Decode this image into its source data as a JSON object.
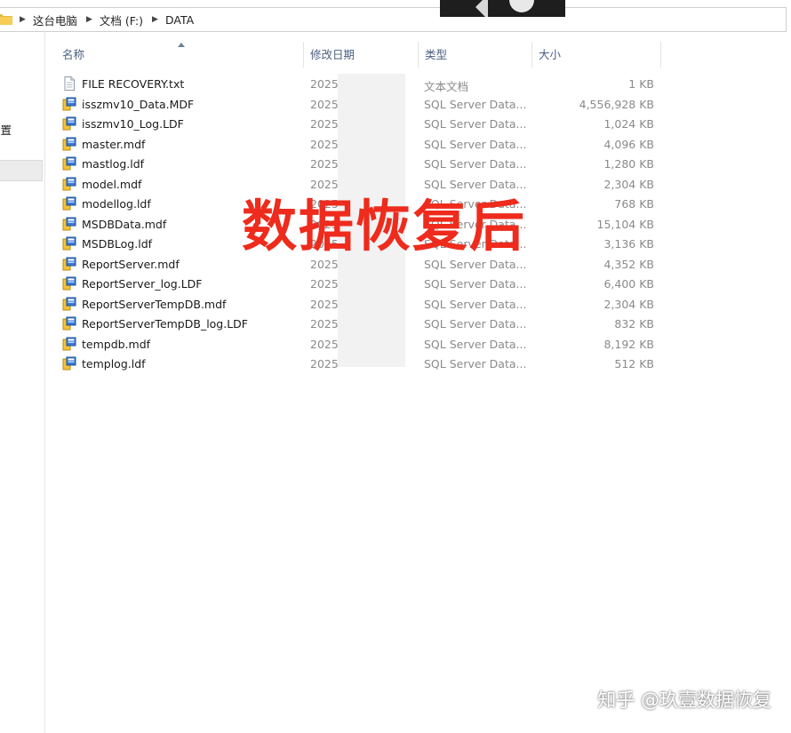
{
  "address": {
    "segments": [
      "这台电脑",
      "文档 (F:)",
      "DATA"
    ]
  },
  "nav": {
    "location_label": "位置"
  },
  "columns": {
    "name": "名称",
    "date": "修改日期",
    "type": "类型",
    "size": "大小"
  },
  "files": [
    {
      "name": "FILE RECOVERY.txt",
      "date": "2025",
      "type": "文本文档",
      "size": "1 KB",
      "icon": "text-file"
    },
    {
      "name": "isszmv10_Data.MDF",
      "date": "2025",
      "type": "SQL Server Data...",
      "size": "4,556,928 KB",
      "icon": "sql-data-file"
    },
    {
      "name": "isszmv10_Log.LDF",
      "date": "2025",
      "type": "SQL Server Data...",
      "size": "1,024 KB",
      "icon": "sql-data-file"
    },
    {
      "name": "master.mdf",
      "date": "2025",
      "type": "SQL Server Data...",
      "size": "4,096 KB",
      "icon": "sql-data-file"
    },
    {
      "name": "mastlog.ldf",
      "date": "2025",
      "type": "SQL Server Data...",
      "size": "1,280 KB",
      "icon": "sql-data-file"
    },
    {
      "name": "model.mdf",
      "date": "2025",
      "type": "SQL Server Data...",
      "size": "2,304 KB",
      "icon": "sql-data-file"
    },
    {
      "name": "modellog.ldf",
      "date": "2025",
      "type": "SQL Server Data...",
      "size": "768 KB",
      "icon": "sql-data-file"
    },
    {
      "name": "MSDBData.mdf",
      "date": "2025",
      "type": "SQL Server Data...",
      "size": "15,104 KB",
      "icon": "sql-data-file"
    },
    {
      "name": "MSDBLog.ldf",
      "date": "2025",
      "type": "SQL Server Data...",
      "size": "3,136 KB",
      "icon": "sql-data-file"
    },
    {
      "name": "ReportServer.mdf",
      "date": "2025",
      "type": "SQL Server Data...",
      "size": "4,352 KB",
      "icon": "sql-data-file"
    },
    {
      "name": "ReportServer_log.LDF",
      "date": "2025",
      "type": "SQL Server Data...",
      "size": "6,400 KB",
      "icon": "sql-data-file"
    },
    {
      "name": "ReportServerTempDB.mdf",
      "date": "2025",
      "type": "SQL Server Data...",
      "size": "2,304 KB",
      "icon": "sql-data-file"
    },
    {
      "name": "ReportServerTempDB_log.LDF",
      "date": "2025",
      "type": "SQL Server Data...",
      "size": "832 KB",
      "icon": "sql-data-file"
    },
    {
      "name": "tempdb.mdf",
      "date": "2025",
      "type": "SQL Server Data...",
      "size": "8,192 KB",
      "icon": "sql-data-file"
    },
    {
      "name": "templog.ldf",
      "date": "2025",
      "type": "SQL Server Data...",
      "size": "512 KB",
      "icon": "sql-data-file"
    }
  ],
  "overlay_text": "数据恢复后",
  "watermark": "知乎 @玖壹数据恢复",
  "colors": {
    "overlay": "#ee2b1c",
    "header_text": "#4a6080",
    "secondary_text": "#8a8a8a"
  }
}
